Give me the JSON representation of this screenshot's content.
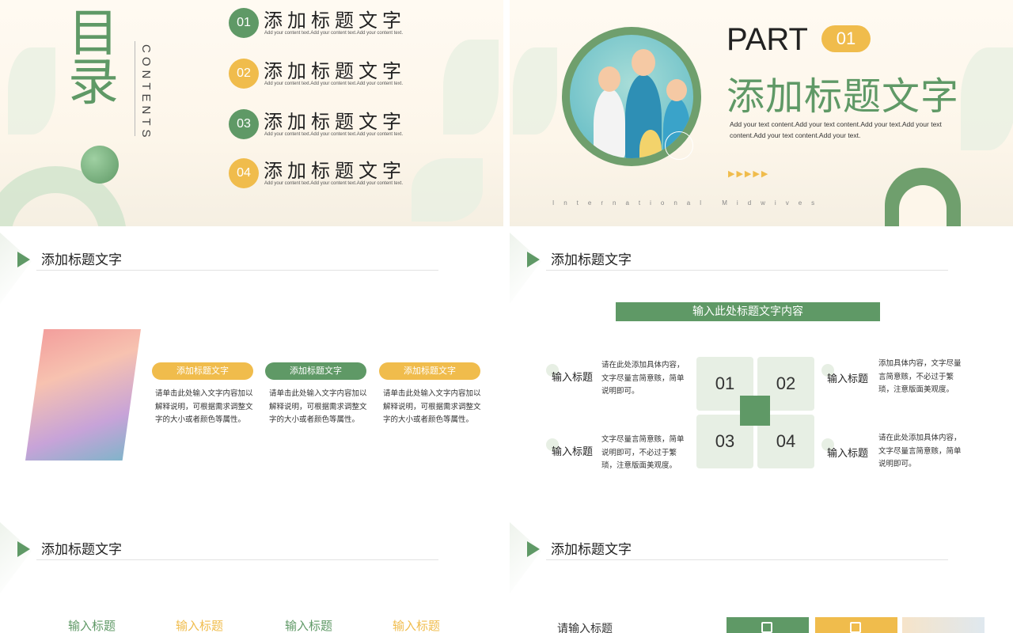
{
  "slide1": {
    "title_cn": "目录",
    "title_en": "CONTENTS",
    "items": [
      {
        "num": "01",
        "title": "添加标题文字",
        "sub": "Add your content text.Add your content text.Add your content text."
      },
      {
        "num": "02",
        "title": "添加标题文字",
        "sub": "Add your content text.Add your content text.Add your content text."
      },
      {
        "num": "03",
        "title": "添加标题文字",
        "sub": "Add your content text.Add your content text.Add your content text."
      },
      {
        "num": "04",
        "title": "添加标题文字",
        "sub": "Add your content text.Add your content text.Add your content text."
      }
    ]
  },
  "slide2": {
    "part_label": "PART",
    "part_num": "01",
    "title": "添加标题文字",
    "description": "Add your text content.Add your text content.Add your text.Add your text content.Add your text content.Add your text.",
    "arrows": "▶▶▶▶▶",
    "footer": "International Midwives"
  },
  "slide3": {
    "header": "添加标题文字",
    "columns": [
      {
        "pill": "添加标题文字",
        "color": "#f0bc4c",
        "text": "请单击此处输入文字内容加以解释说明，可根据需求调整文字的大小或者颜色等属性。"
      },
      {
        "pill": "添加标题文字",
        "color": "#5f9966",
        "text": "请单击此处输入文字内容加以解释说明，可根据需求调整文字的大小或者颜色等属性。"
      },
      {
        "pill": "添加标题文字",
        "color": "#f0bc4c",
        "text": "请单击此处输入文字内容加以解释说明，可根据需求调整文字的大小或者颜色等属性。"
      }
    ]
  },
  "slide4": {
    "header": "添加标题文字",
    "banner": "输入此处标题文字内容",
    "quads": [
      "01",
      "02",
      "03",
      "04"
    ],
    "blocks": [
      {
        "label": "输入标题",
        "text": "请在此处添加具体内容，文字尽量言简意赅，简单说明即可。"
      },
      {
        "label": "输入标题",
        "text": "添加具体内容，文字尽量言简意赅，不必过于繁琐，注意版面美观度。"
      },
      {
        "label": "输入标题",
        "text": "文字尽量言简意赅，简单说明即可，不必过于繁琐，注意版面美观度。"
      },
      {
        "label": "输入标题",
        "text": "请在此处添加具体内容，文字尽量言简意赅，简单说明即可。"
      }
    ]
  },
  "slide5": {
    "header": "添加标题文字",
    "labels": [
      {
        "text": "输入标题",
        "color": "#5f9966"
      },
      {
        "text": "输入标题",
        "color": "#f0bc4c"
      },
      {
        "text": "输入标题",
        "color": "#5f9966"
      },
      {
        "text": "输入标题",
        "color": "#f0bc4c"
      }
    ]
  },
  "slide6": {
    "header": "添加标题文字",
    "label": "请输入标题"
  },
  "colors": {
    "green": "#5f9966",
    "yellow": "#f0bc4c",
    "light_green": "#e7efe4"
  }
}
